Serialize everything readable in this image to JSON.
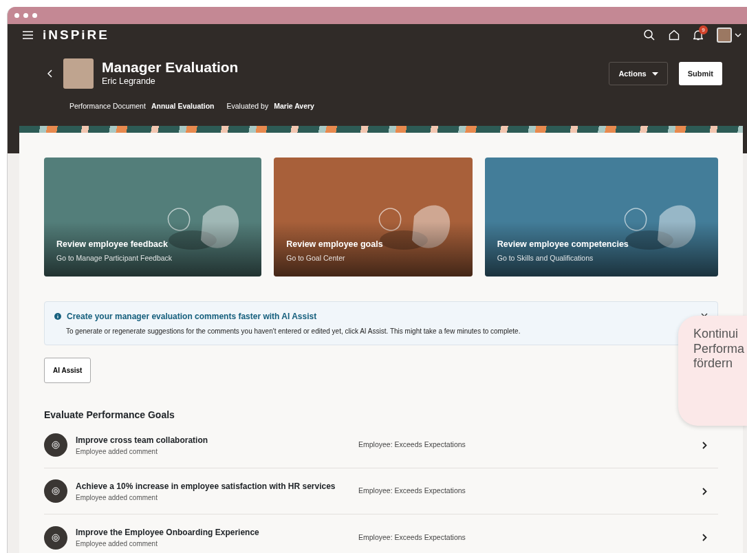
{
  "app": {
    "logo": "iNSPiRE",
    "notification_count": "9"
  },
  "header": {
    "title": "Manager Evaluation",
    "subtitle": "Eric Legrande",
    "actions": [
      {
        "label": "Actions",
        "kind": "dropdown"
      },
      {
        "label": "Submit",
        "kind": "primary"
      }
    ],
    "meta": [
      {
        "label": "Performance Document",
        "value": "Annual Evaluation"
      },
      {
        "label": "Evaluated by",
        "value": "Marie Avery"
      }
    ]
  },
  "tiles": [
    {
      "title": "Review employee feedback",
      "subtitle": "Go to Manage Participant Feedback",
      "color": "#537e7a"
    },
    {
      "title": "Review employee goals",
      "subtitle": "Go to Goal Center",
      "color": "#a8603a"
    },
    {
      "title": "Review employee competencies",
      "subtitle": "Go to Skills and Qualifications",
      "color": "#437d99"
    }
  ],
  "banner": {
    "title": "Create your manager evaluation comments faster with AI Assist",
    "text": "To generate or regenerate suggestions for the comments you haven't entered or edited yet, click AI Assist. This might take a few minutes to complete."
  },
  "ai_button": "AI Assist",
  "callout": {
    "lines": [
      "Kontinui",
      "Performa",
      "fördern"
    ]
  },
  "section": {
    "title": "Evaluate Performance Goals",
    "goals": [
      {
        "title": "Improve cross team collaboration",
        "note": "Employee added comment",
        "rating": "Employee: Exceeds Expectations"
      },
      {
        "title": "Achieve a 10% increase in employee satisfaction with HR services",
        "note": "Employee added comment",
        "rating": "Employee: Exceeds Expectations"
      },
      {
        "title": "Improve the Employee Onboarding Experience",
        "note": "Employee added comment",
        "rating": "Employee: Exceeds Expectations"
      }
    ]
  }
}
